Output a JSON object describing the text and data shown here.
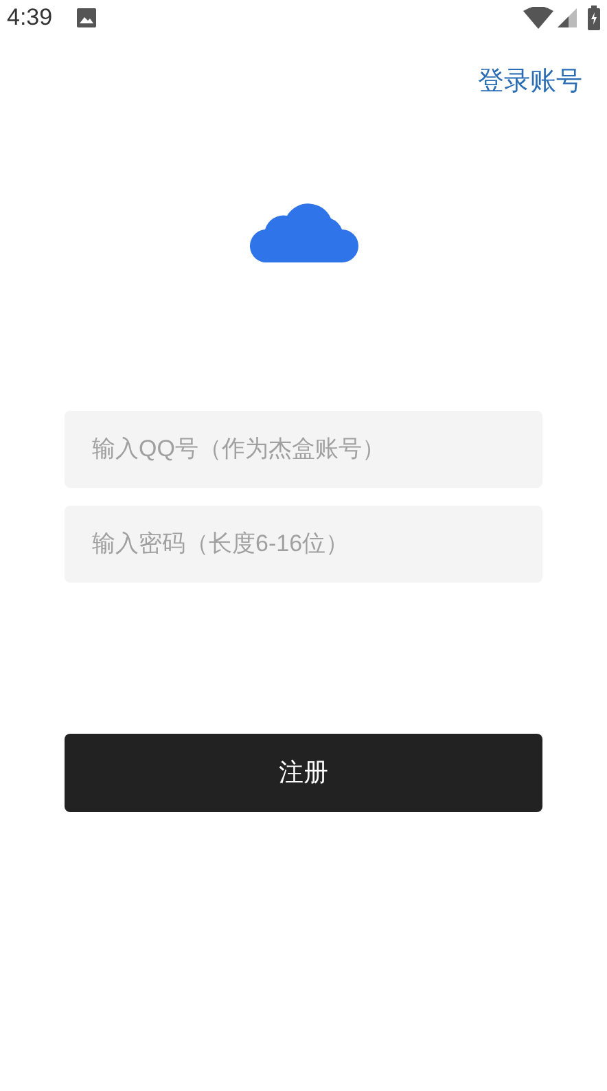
{
  "status_bar": {
    "time": "4:39"
  },
  "login_link": "登录账号",
  "fields": [
    {
      "placeholder": "输入QQ号（作为杰盒账号）"
    },
    {
      "placeholder": "输入密码（长度6-16位）"
    }
  ],
  "register_button": "注册"
}
